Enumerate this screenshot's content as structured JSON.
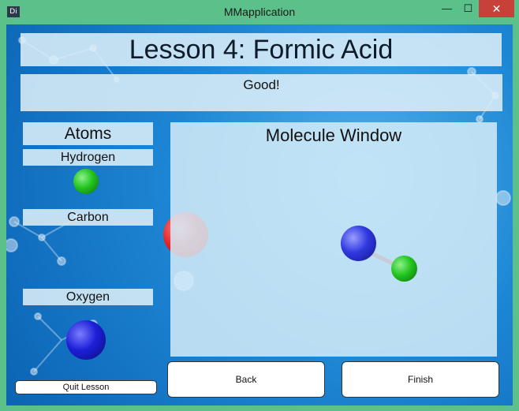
{
  "window": {
    "title": "MMapplication",
    "icon_text": "Di",
    "minimize_glyph": "—",
    "maximize_glyph": "☐",
    "close_glyph": "✕"
  },
  "lesson_title": "Lesson 4: Formic Acid",
  "feedback": "Good!",
  "atoms_panel": {
    "heading": "Atoms",
    "items": [
      {
        "label": "Hydrogen",
        "color": "#22c51f"
      },
      {
        "label": "Carbon",
        "color": "#1d1fd8"
      },
      {
        "label": "Oxygen",
        "color": "#e5262a"
      }
    ]
  },
  "molecule_window": {
    "title": "Molecule Window"
  },
  "buttons": {
    "quit": "Quit Lesson",
    "back": "Back",
    "finish": "Finish"
  },
  "colors": {
    "hydrogen": "#22c51f",
    "carbon": "#3038e0",
    "oxygen": "#e5262a",
    "background": "#1d86d4",
    "titlebar": "#5bc08a",
    "close": "#c7403a"
  }
}
